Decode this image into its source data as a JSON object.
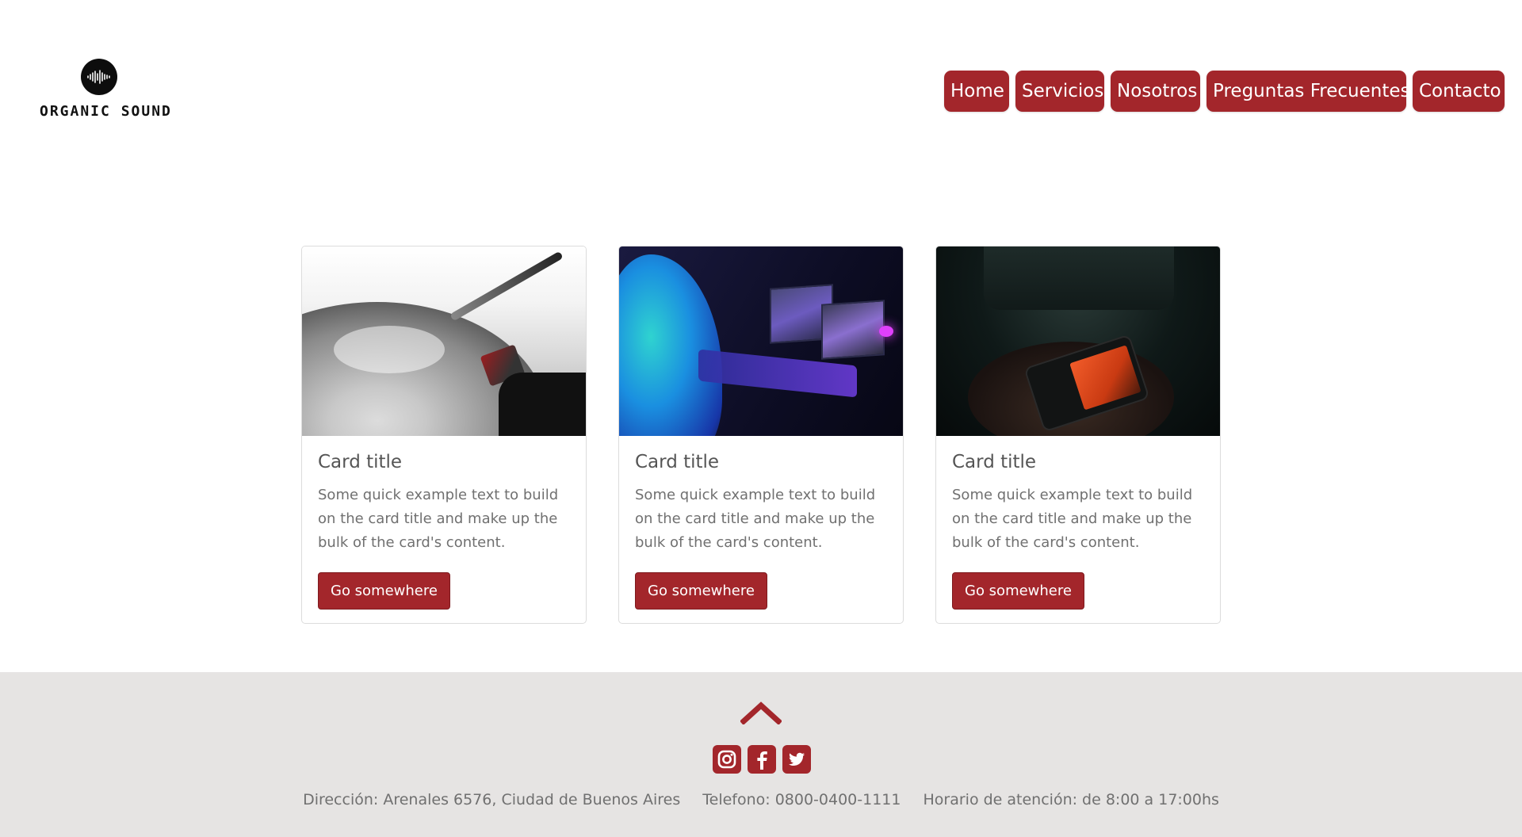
{
  "header": {
    "logo_text": "ORGANIC SOUND",
    "nav": [
      {
        "label": "Home"
      },
      {
        "label": "Servicios"
      },
      {
        "label": "Nosotros"
      },
      {
        "label": "Preguntas Frecuentes"
      },
      {
        "label": "Contacto"
      }
    ]
  },
  "cards": [
    {
      "title": "Card title",
      "text": "Some quick example text to build on the card title and make up the bulk of the card's content.",
      "button": "Go somewhere",
      "image": "turntable"
    },
    {
      "title": "Card title",
      "text": "Some quick example text to build on the card title and make up the bulk of the card's content.",
      "button": "Go somewhere",
      "image": "dj-laptops"
    },
    {
      "title": "Card title",
      "text": "Some quick example text to build on the card title and make up the bulk of the card's content.",
      "button": "Go somewhere",
      "image": "phone-music"
    }
  ],
  "footer": {
    "address": "Dirección: Arenales 6576, Ciudad de Buenos Aires",
    "phone": "Telefono: 0800-0400-1111",
    "hours": "Horario de atención: de 8:00 a 17:00hs",
    "social": [
      "instagram-icon",
      "facebook-icon",
      "twitter-icon"
    ]
  },
  "colors": {
    "accent": "#a3262b",
    "footer_bg": "#e6e4e3"
  }
}
